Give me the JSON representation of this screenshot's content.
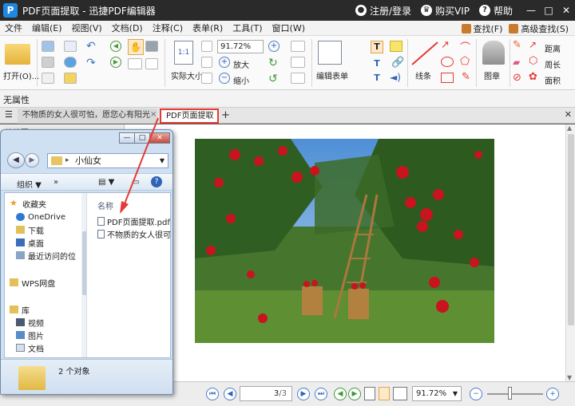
{
  "titlebar": {
    "logo_text": "P",
    "title": "PDF页面提取 - 迅捷PDF编辑器",
    "login": "注册/登录",
    "buy_vip": "购买VIP",
    "help": "帮助",
    "min": "—",
    "max": "□",
    "close": "✕"
  },
  "menubar": {
    "items": [
      "文件",
      "编辑(E)",
      "视图(V)",
      "文档(D)",
      "注释(C)",
      "表单(R)",
      "工具(T)",
      "窗口(W)"
    ],
    "find": "查找(F)",
    "advanced_find": "高级查找(S)"
  },
  "ribbon": {
    "open": "打开(O)...",
    "actual_size": "实际大小",
    "zoom_value": "91.72%",
    "zoom_in": "放大",
    "zoom_out": "缩小",
    "edit_form": "编辑表单",
    "line": "线条",
    "stamp": "图章",
    "distance": "距离",
    "perimeter": "周长",
    "area": "面积",
    "page_size_text": "1:1"
  },
  "propbar": {
    "label": "无属性"
  },
  "tabs": {
    "inactive": "不物质的女人很可怕，愿您心有阳光",
    "active": "PDF页面提取",
    "close": "×",
    "add": "+",
    "close_all": "✕"
  },
  "left_panel": {
    "label": "缩略图"
  },
  "statusbar": {
    "page_current": "3",
    "page_total": "/3",
    "zoom": "91.72%"
  },
  "explorer": {
    "min": "—",
    "max": "□",
    "close": "✕",
    "address": "小仙女",
    "organize": "组织 ▼",
    "more": "»",
    "nav": [
      {
        "label": "收藏夹",
        "icon": "star-icon"
      },
      {
        "label": "OneDrive",
        "icon": "cloud-icon"
      },
      {
        "label": "下载",
        "icon": "download-folder-icon"
      },
      {
        "label": "桌面",
        "icon": "desktop-icon"
      },
      {
        "label": "最近访问的位",
        "icon": "recent-places-icon"
      },
      {
        "label": "WPS网盘",
        "icon": "wps-drive-icon"
      },
      {
        "label": "库",
        "icon": "library-icon"
      },
      {
        "label": "视频",
        "icon": "video-library-icon"
      },
      {
        "label": "图片",
        "icon": "pictures-library-icon"
      },
      {
        "label": "文档",
        "icon": "documents-library-icon"
      }
    ],
    "column_header": "名称",
    "files": [
      "PDF页面提取.pdf",
      "不物质的女人很可"
    ],
    "count": "2 个对象"
  },
  "colors": {
    "title_bg": "#2a2a2a",
    "accent_red": "#e53935",
    "explorer_frame": "#cfe0f2",
    "sky": "#6a9fd8",
    "grass": "#3d6b2a",
    "apple": "#c8141e"
  }
}
